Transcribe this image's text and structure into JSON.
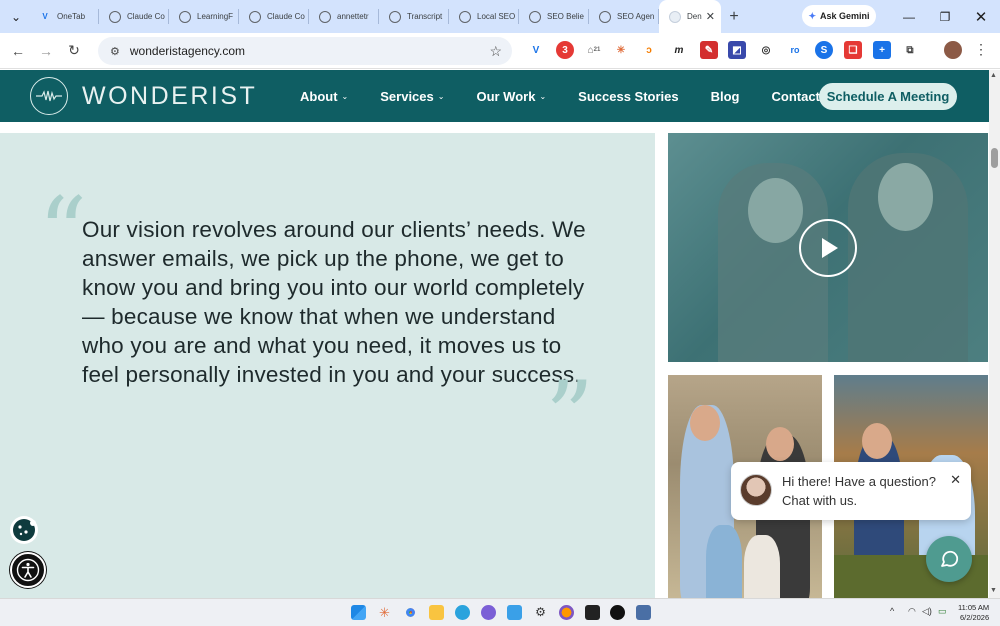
{
  "browser": {
    "tabs": [
      {
        "label": "OneTab",
        "color": "#1a73e8"
      },
      {
        "label": "Claude Co",
        "color": "#5f6368"
      },
      {
        "label": "LearningF",
        "color": "#5f6368"
      },
      {
        "label": "Claude Co",
        "color": "#5f6368"
      },
      {
        "label": "annettetr",
        "color": "#5f6368"
      },
      {
        "label": "Transcript",
        "color": "#5f6368"
      },
      {
        "label": "Local SEO",
        "color": "#5f6368"
      },
      {
        "label": "SEO Belie",
        "color": "#5f6368"
      },
      {
        "label": "SEO Agen",
        "color": "#5f6368"
      }
    ],
    "active_tab": {
      "label": "Den"
    },
    "gemini_label": "Ask Gemini",
    "url": "wonderistagency.com",
    "extension_badges": {
      "notif": "3",
      "count": "21"
    }
  },
  "site": {
    "logo_text": "WONDERIST",
    "nav": [
      {
        "label": "About",
        "has_dropdown": true
      },
      {
        "label": "Services",
        "has_dropdown": true
      },
      {
        "label": "Our Work",
        "has_dropdown": true
      },
      {
        "label": "Success Stories",
        "has_dropdown": false
      },
      {
        "label": "Blog",
        "has_dropdown": false
      },
      {
        "label": "Contact",
        "has_dropdown": false
      }
    ],
    "cta_label": "Schedule A Meeting",
    "colors": {
      "header": "#0f5e63",
      "panel": "#d8e9e7",
      "accent": "#4f9b90"
    }
  },
  "quote": {
    "text": "Our vision revolves around our clients’ needs. We answer emails, we pick up the phone, we get to know you and bring you into our world completely — because we know that when we understand who you are and what you need, it moves us to feel personally invested in you and your success."
  },
  "chat": {
    "line1": "Hi there! Have a question?",
    "line2": "Chat with us."
  },
  "taskbar": {
    "time": "11:05 AM",
    "date": "6/2/2026"
  }
}
